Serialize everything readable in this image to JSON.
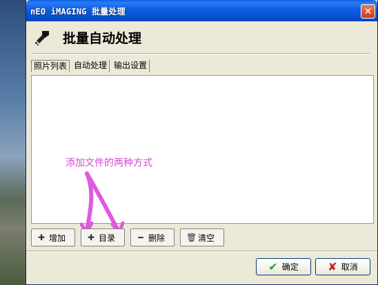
{
  "window": {
    "title": "nEO iMAGING 批量处理",
    "close_label": "✕"
  },
  "header": {
    "title": "批量自动处理"
  },
  "tabs": [
    {
      "label": "照片列表",
      "active": true
    },
    {
      "label": "自动处理",
      "active": false
    },
    {
      "label": "输出设置",
      "active": false
    }
  ],
  "annotation": {
    "text": "添加文件的两种方式"
  },
  "toolbar": {
    "add": {
      "label": "增加",
      "icon": "plus-icon"
    },
    "folder": {
      "label": "目录",
      "icon": "plus-icon"
    },
    "delete": {
      "label": "删除",
      "icon": "minus-icon"
    },
    "clear": {
      "label": "清空",
      "icon": "trash-icon"
    }
  },
  "dialog": {
    "ok_label": "确定",
    "cancel_label": "取消"
  },
  "colors": {
    "titlebar": "#0a5ee6",
    "annotation": "#d24ad0",
    "ok_icon": "#2e9e2e",
    "cancel_icon": "#c02020"
  }
}
